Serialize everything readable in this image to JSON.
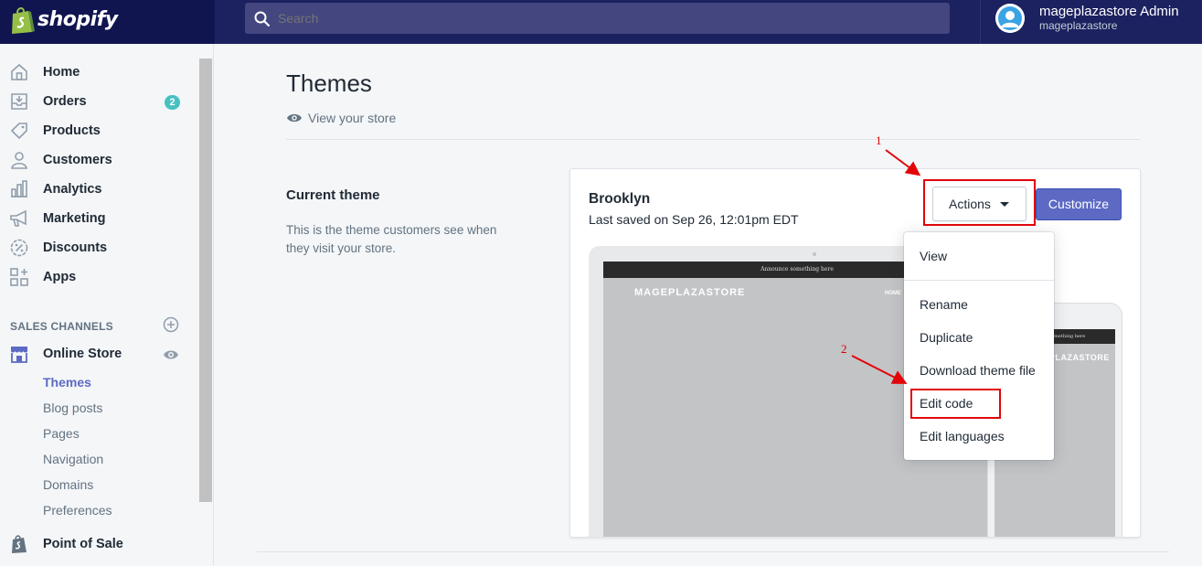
{
  "brand": {
    "logo_text": "shopify"
  },
  "topbar": {
    "search_placeholder": "Search",
    "user_name": "mageplazastore Admin",
    "user_store": "mageplazastore"
  },
  "sidebar": {
    "items": [
      {
        "label": "Home",
        "icon": "home-icon"
      },
      {
        "label": "Orders",
        "icon": "orders-icon",
        "badge": "2"
      },
      {
        "label": "Products",
        "icon": "tag-icon"
      },
      {
        "label": "Customers",
        "icon": "person-icon"
      },
      {
        "label": "Analytics",
        "icon": "bar-chart-icon"
      },
      {
        "label": "Marketing",
        "icon": "megaphone-icon"
      },
      {
        "label": "Discounts",
        "icon": "discount-icon"
      },
      {
        "label": "Apps",
        "icon": "apps-icon"
      }
    ],
    "sales_channels_heading": "SALES CHANNELS",
    "online_store": {
      "label": "Online Store",
      "icon": "store-icon"
    },
    "sub_items": [
      "Themes",
      "Blog posts",
      "Pages",
      "Navigation",
      "Domains",
      "Preferences"
    ],
    "active_sub_item": "Themes",
    "point_of_sale": {
      "label": "Point of Sale",
      "icon": "shopify-bag-icon"
    }
  },
  "main": {
    "title": "Themes",
    "view_store_label": "View your store",
    "current_theme": {
      "heading": "Current theme",
      "description": "This is the theme customers see when they visit your store."
    },
    "theme_card": {
      "name": "Brooklyn",
      "saved": "Last saved on Sep 26, 12:01pm EDT",
      "actions_label": "Actions",
      "customize_label": "Customize",
      "preview": {
        "announcement": "Announce something here",
        "brand": "MAGEPLAZASTORE",
        "nav": "HOME",
        "phone_brand": "PLAZASTORE"
      }
    },
    "actions_menu": [
      "View",
      "Rename",
      "Duplicate",
      "Download theme file",
      "Edit code",
      "Edit languages"
    ]
  },
  "annotations": {
    "step1": "1",
    "step2": "2",
    "color": "#e1050a"
  },
  "colors": {
    "topbar": "#1c2260",
    "accent": "#5c6ac4",
    "badge": "#47c1bf"
  }
}
